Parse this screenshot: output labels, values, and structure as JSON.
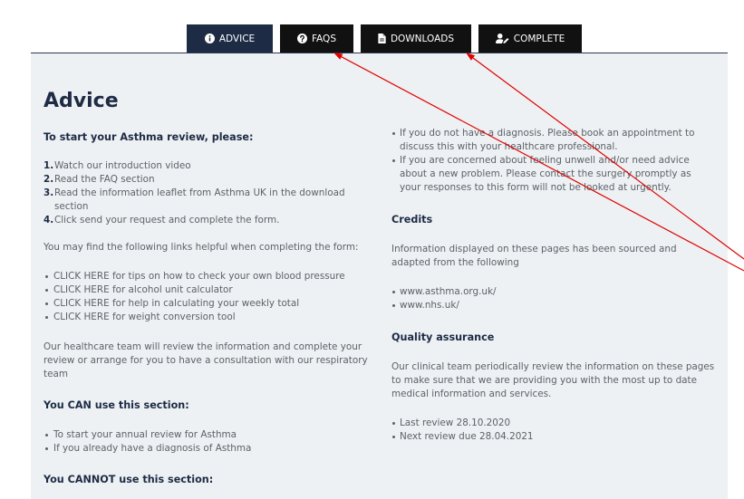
{
  "tabs": [
    {
      "label": "ADVICE",
      "icon": "info-circle-icon",
      "active": true
    },
    {
      "label": "FAQS",
      "icon": "question-circle-icon",
      "active": false
    },
    {
      "label": "DOWNLOADS",
      "icon": "file-icon",
      "active": false
    },
    {
      "label": "COMPLETE",
      "icon": "user-edit-icon",
      "active": false
    }
  ],
  "colors": {
    "accent": "#1d2b45",
    "tab_inactive": "#111111",
    "panel_bg": "#edf1f3",
    "body_text": "#5c6269",
    "annotation": "#e00000"
  },
  "advice": {
    "title": "Advice",
    "intro_heading": "To start your Asthma review, please:",
    "steps": [
      {
        "number": "1.",
        "text": "Watch our introduction video"
      },
      {
        "number": "2.",
        "text": "Read the FAQ section"
      },
      {
        "number": "3.",
        "text": "Read the information leaflet from Asthma UK in the download section"
      },
      {
        "number": "4.",
        "text": "Click send your request and complete the form."
      }
    ],
    "links_intro": "You may find the following links helpful when completing the form:",
    "helpful_links": [
      {
        "link": "CLICK HERE",
        "text": "for tips on how to check your own blood pressure"
      },
      {
        "link": "CLICK HERE",
        "text": "for alcohol unit calculator"
      },
      {
        "link": "CLICK HERE",
        "text": "for help in calculating your weekly total"
      },
      {
        "link": "CLICK HERE",
        "text": "for weight conversion tool"
      }
    ],
    "team_note": "Our healthcare team will review the information and complete your review or arrange for you to have a consultation with our respiratory team",
    "can_use": {
      "heading": "You CAN use this section:",
      "items": [
        "To start your annual review for Asthma",
        "If you already have a diagnosis of Asthma"
      ]
    },
    "cannot_use": {
      "heading": "You CANNOT use this section:",
      "items": [
        "If you do not have a diagnosis. Please book an appointment to discuss this with your healthcare professional.",
        "If you are concerned about feeling unwell and/or need advice about a new problem. Please contact the surgery promptly as your responses to this form will not be looked at urgently."
      ]
    },
    "credits": {
      "heading": "Credits",
      "text": "Information displayed on these pages has been sourced and adapted from the following",
      "links": [
        "www.asthma.org.uk/",
        "www.nhs.uk/"
      ]
    },
    "quality_assurance": {
      "heading": "Quality assurance",
      "text": "Our clinical team periodically review the information on these pages to make sure that we are providing you with the most up to date medical information and services.",
      "items": [
        "Last review 28.10.2020",
        "Next review due 28.04.2021"
      ]
    }
  }
}
